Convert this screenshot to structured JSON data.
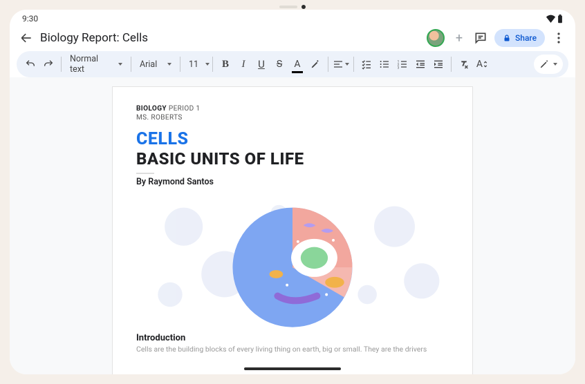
{
  "status": {
    "time": "9:30"
  },
  "header": {
    "title": "Biology Report: Cells",
    "share_label": "Share"
  },
  "toolbar": {
    "style_label": "Normal text",
    "font_label": "Arial",
    "font_size": "11"
  },
  "doc": {
    "meta_course": "BIOLOGY",
    "meta_period": "PERIOD 1",
    "meta_teacher": "MS. ROBERTS",
    "title_1": "CELLS",
    "title_2": "BASIC UNITS OF LIFE",
    "byline": "By Raymond Santos",
    "section_heading": "Introduction",
    "body_preview": "Cells are the building blocks of every living thing on earth, big or small. They are the drivers"
  }
}
